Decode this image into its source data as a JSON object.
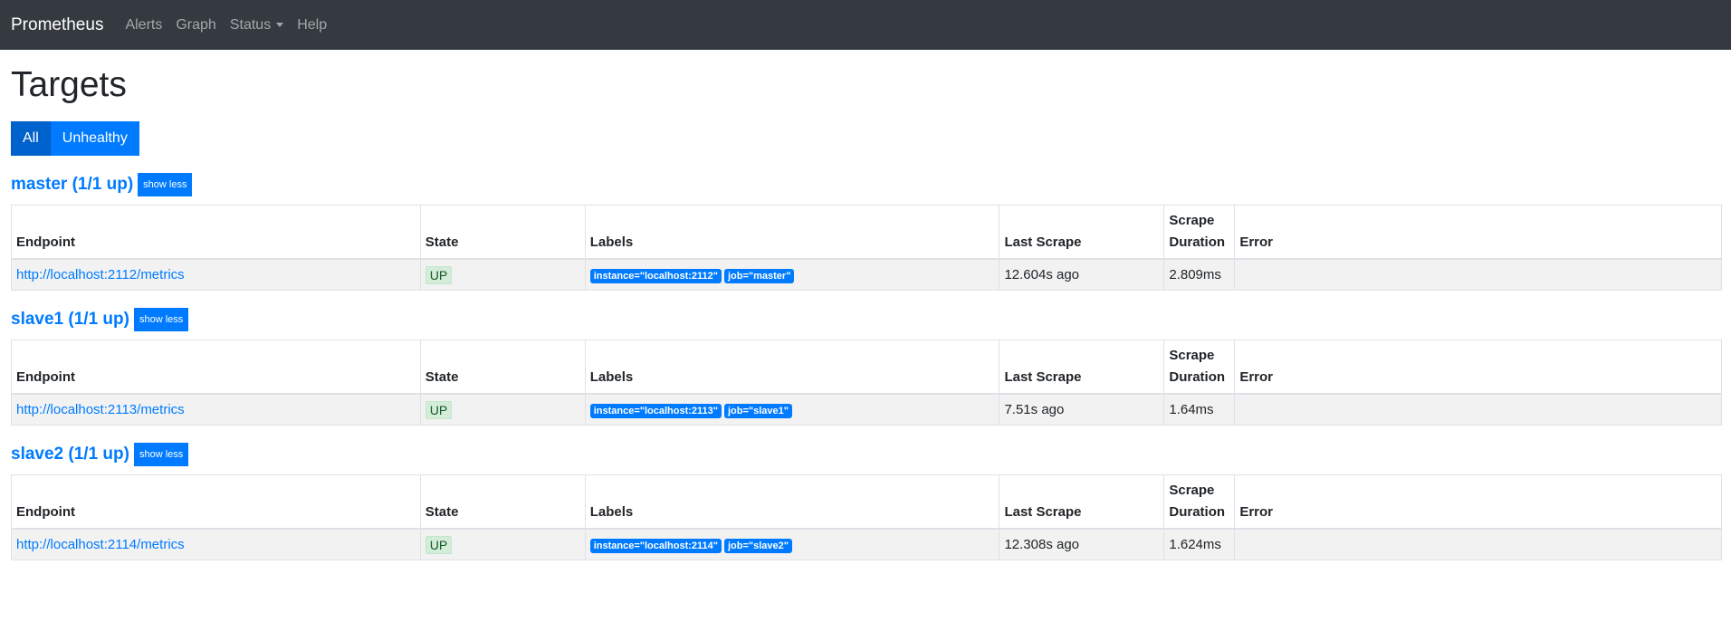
{
  "nav": {
    "brand": "Prometheus",
    "links": [
      "Alerts",
      "Graph",
      "Status",
      "Help"
    ]
  },
  "page": {
    "title": "Targets",
    "filter_buttons": [
      "All",
      "Unhealthy"
    ],
    "active_filter": "All"
  },
  "table_headers": {
    "endpoint": "Endpoint",
    "state": "State",
    "labels": "Labels",
    "last_scrape": "Last Scrape",
    "scrape_duration_line1": "Scrape",
    "scrape_duration_line2": "Duration",
    "error": "Error"
  },
  "pools": [
    {
      "title": "master (1/1 up)",
      "toggle_label": "show less",
      "rows": [
        {
          "endpoint": "http://localhost:2112/metrics",
          "state": "UP",
          "labels": [
            "instance=\"localhost:2112\"",
            "job=\"master\""
          ],
          "last_scrape": "12.604s ago",
          "duration": "2.809ms",
          "error": ""
        }
      ]
    },
    {
      "title": "slave1 (1/1 up)",
      "toggle_label": "show less",
      "rows": [
        {
          "endpoint": "http://localhost:2113/metrics",
          "state": "UP",
          "labels": [
            "instance=\"localhost:2113\"",
            "job=\"slave1\""
          ],
          "last_scrape": "7.51s ago",
          "duration": "1.64ms",
          "error": ""
        }
      ]
    },
    {
      "title": "slave2 (1/1 up)",
      "toggle_label": "show less",
      "rows": [
        {
          "endpoint": "http://localhost:2114/metrics",
          "state": "UP",
          "labels": [
            "instance=\"localhost:2114\"",
            "job=\"slave2\""
          ],
          "last_scrape": "12.308s ago",
          "duration": "1.624ms",
          "error": ""
        }
      ]
    }
  ],
  "colors": {
    "navbar": "#343a40",
    "primary": "#007bff",
    "up_bg": "#d4edda",
    "up_text": "#155724"
  }
}
